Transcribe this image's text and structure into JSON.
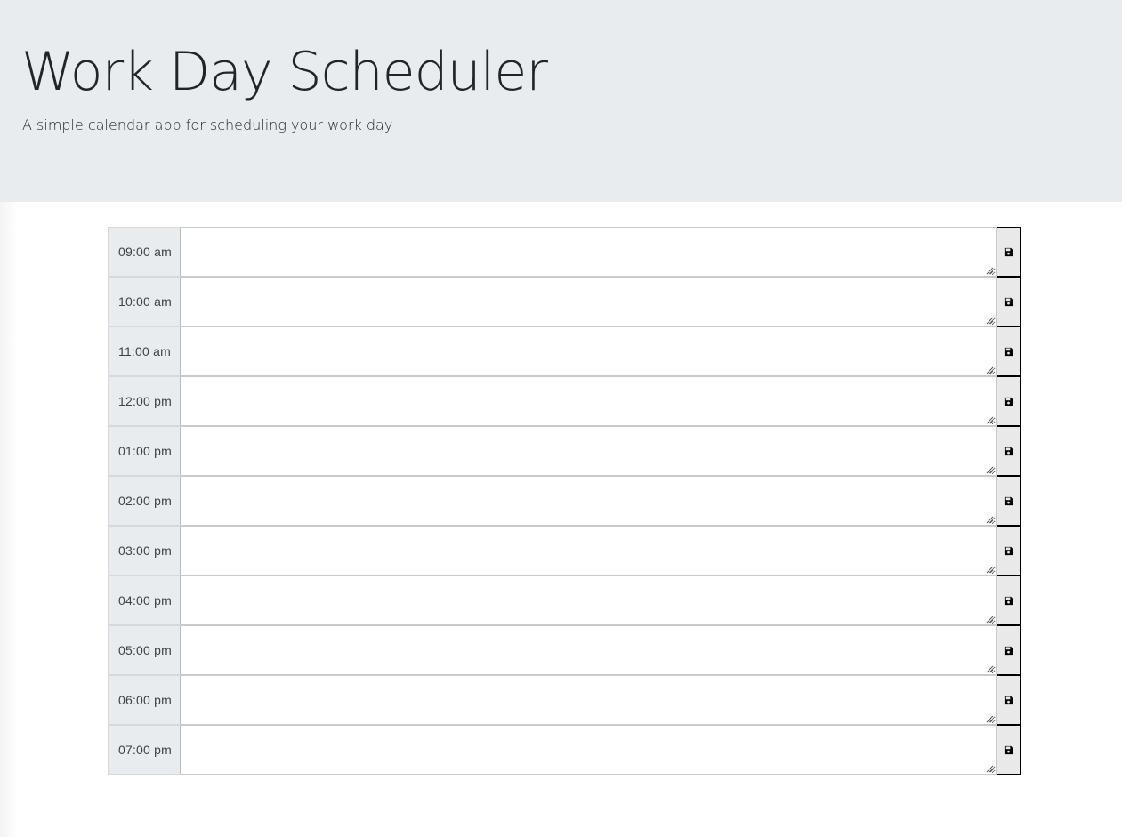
{
  "header": {
    "title": "Work Day Scheduler",
    "subtitle": "A simple calendar app for scheduling your work day"
  },
  "schedule": {
    "rows": [
      {
        "hour": "09:00 am",
        "text": ""
      },
      {
        "hour": "10:00 am",
        "text": ""
      },
      {
        "hour": "11:00 am",
        "text": ""
      },
      {
        "hour": "12:00 pm",
        "text": ""
      },
      {
        "hour": "01:00 pm",
        "text": ""
      },
      {
        "hour": "02:00 pm",
        "text": ""
      },
      {
        "hour": "03:00 pm",
        "text": ""
      },
      {
        "hour": "04:00 pm",
        "text": ""
      },
      {
        "hour": "05:00 pm",
        "text": ""
      },
      {
        "hour": "06:00 pm",
        "text": ""
      },
      {
        "hour": "07:00 pm",
        "text": ""
      }
    ],
    "save_icon": "floppy-disk-icon"
  },
  "colors": {
    "header_background": "#e9ecef",
    "hour_background": "#e9ecef",
    "save_button_background": "#e9e9e9"
  }
}
